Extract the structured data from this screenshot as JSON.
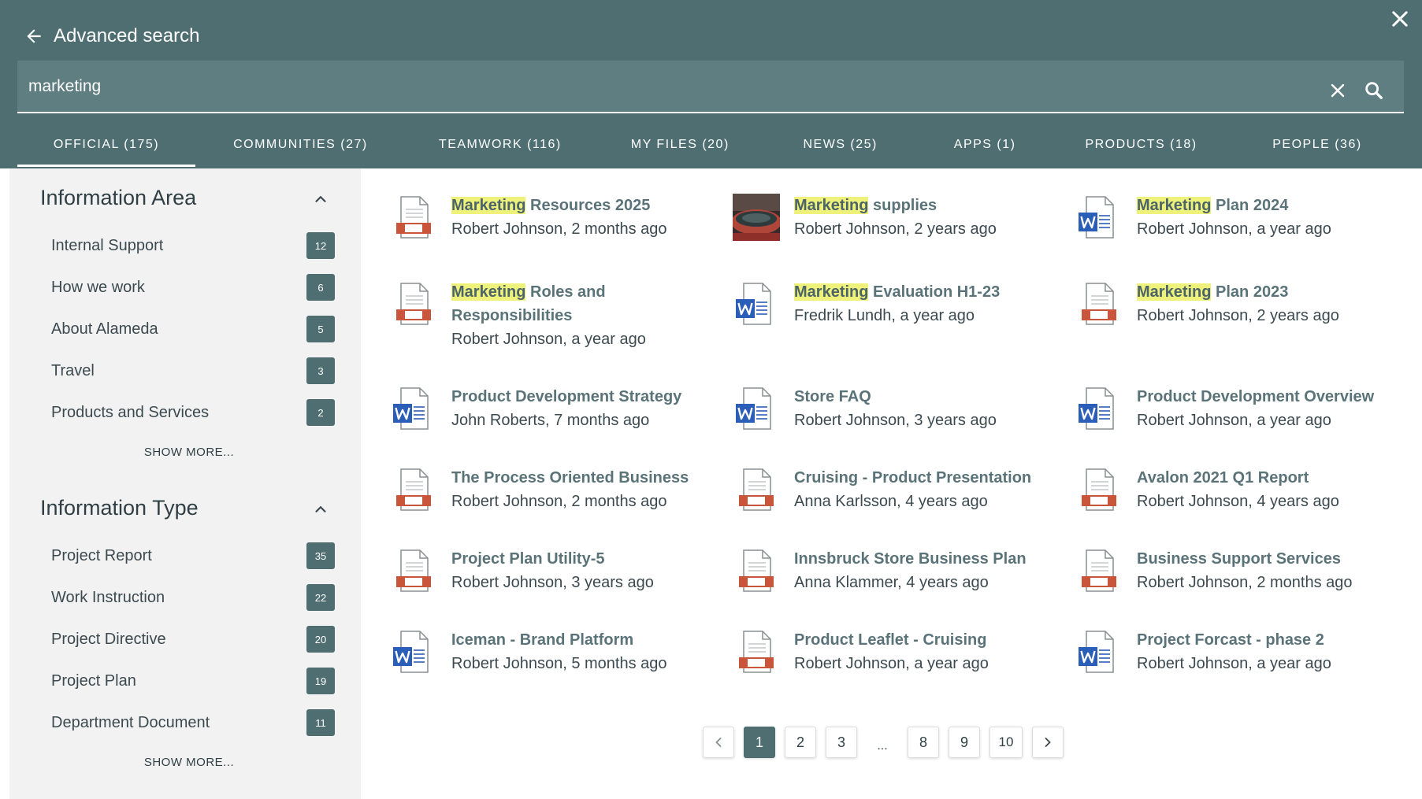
{
  "header": {
    "title": "Advanced search",
    "search_value": "marketing"
  },
  "tabs": [
    {
      "label": "OFFICIAL (175)",
      "active": true
    },
    {
      "label": "COMMUNITIES (27)"
    },
    {
      "label": "TEAMWORK (116)"
    },
    {
      "label": "MY FILES (20)"
    },
    {
      "label": "NEWS (25)"
    },
    {
      "label": "APPS (1)"
    },
    {
      "label": "PRODUCTS (18)"
    },
    {
      "label": "PEOPLE (36)"
    }
  ],
  "sidebar": {
    "information_area": {
      "title": "Information Area",
      "items": [
        {
          "label": "Internal Support",
          "count": "12"
        },
        {
          "label": "How we work",
          "count": "6"
        },
        {
          "label": "About Alameda",
          "count": "5"
        },
        {
          "label": "Travel",
          "count": "3"
        },
        {
          "label": "Products and Services",
          "count": "2"
        }
      ],
      "show_more": "SHOW MORE..."
    },
    "information_type": {
      "title": "Information Type",
      "items": [
        {
          "label": "Project Report",
          "count": "35"
        },
        {
          "label": "Work Instruction",
          "count": "22"
        },
        {
          "label": "Project Directive",
          "count": "20"
        },
        {
          "label": "Project Plan",
          "count": "19"
        },
        {
          "label": "Department Document",
          "count": "11"
        }
      ],
      "show_more": "SHOW MORE..."
    }
  },
  "results": [
    {
      "highlight": "Marketing",
      "title": " Resources 2025",
      "meta": "Robert Johnson, 2 months ago",
      "icon": "presentation-icon"
    },
    {
      "highlight": "Marketing",
      "title": " supplies",
      "meta": "Robert Johnson, 2 years ago",
      "icon": "image-thumbnail"
    },
    {
      "highlight": "Marketing",
      "title": " Plan 2024",
      "meta": "Robert Johnson, a year ago",
      "icon": "word-doc-icon"
    },
    {
      "highlight": "Marketing",
      "title": " Roles and Responsibilities",
      "meta": "Robert Johnson, a year ago",
      "icon": "presentation-icon"
    },
    {
      "highlight": "Marketing",
      "title": " Evaluation H1-23",
      "meta": "Fredrik Lundh, a year ago",
      "icon": "word-doc-icon"
    },
    {
      "highlight": "Marketing",
      "title": " Plan 2023",
      "meta": "Robert Johnson, 2 years ago",
      "icon": "presentation-icon"
    },
    {
      "highlight": "",
      "title": "Product Development Strategy",
      "meta": "John Roberts, 7 months ago",
      "icon": "word-doc-icon"
    },
    {
      "highlight": "",
      "title": "Store FAQ",
      "meta": "Robert Johnson, 3 years ago",
      "icon": "word-doc-icon"
    },
    {
      "highlight": "",
      "title": "Product Development Overview",
      "meta": "Robert Johnson, a year ago",
      "icon": "word-doc-icon"
    },
    {
      "highlight": "",
      "title": "The Process Oriented Business",
      "meta": "Robert Johnson, 2 months ago",
      "icon": "presentation-icon"
    },
    {
      "highlight": "",
      "title": "Cruising - Product Presentation",
      "meta": "Anna Karlsson, 4 years ago",
      "icon": "presentation-icon"
    },
    {
      "highlight": "",
      "title": "Avalon 2021 Q1 Report",
      "meta": "Robert Johnson, 4 years ago",
      "icon": "presentation-icon"
    },
    {
      "highlight": "",
      "title": "Project Plan Utility-5",
      "meta": "Robert Johnson, 3 years ago",
      "icon": "presentation-icon"
    },
    {
      "highlight": "",
      "title": "Innsbruck Store Business Plan",
      "meta": "Anna Klammer, 4 years ago",
      "icon": "presentation-icon"
    },
    {
      "highlight": "",
      "title": "Business Support Services",
      "meta": "Robert Johnson, 2 months ago",
      "icon": "presentation-icon"
    },
    {
      "highlight": "",
      "title": "Iceman - Brand Platform",
      "meta": "Robert Johnson, 5 months ago",
      "icon": "word-doc-icon"
    },
    {
      "highlight": "",
      "title": "Product Leaflet - Cruising",
      "meta": "Robert Johnson, a year ago",
      "icon": "presentation-icon"
    },
    {
      "highlight": "",
      "title": "Project Forcast - phase 2",
      "meta": "Robert Johnson, a year ago",
      "icon": "word-doc-icon"
    }
  ],
  "pagination": {
    "pages_start": [
      "1",
      "2",
      "3"
    ],
    "ellipsis": "...",
    "pages_end": [
      "8",
      "9",
      "10"
    ],
    "current": "1"
  },
  "colors": {
    "header_bg": "#4e6e72",
    "highlight": "#eef27a",
    "accent_red": "#c9553a",
    "word_blue": "#2b5eb8"
  }
}
